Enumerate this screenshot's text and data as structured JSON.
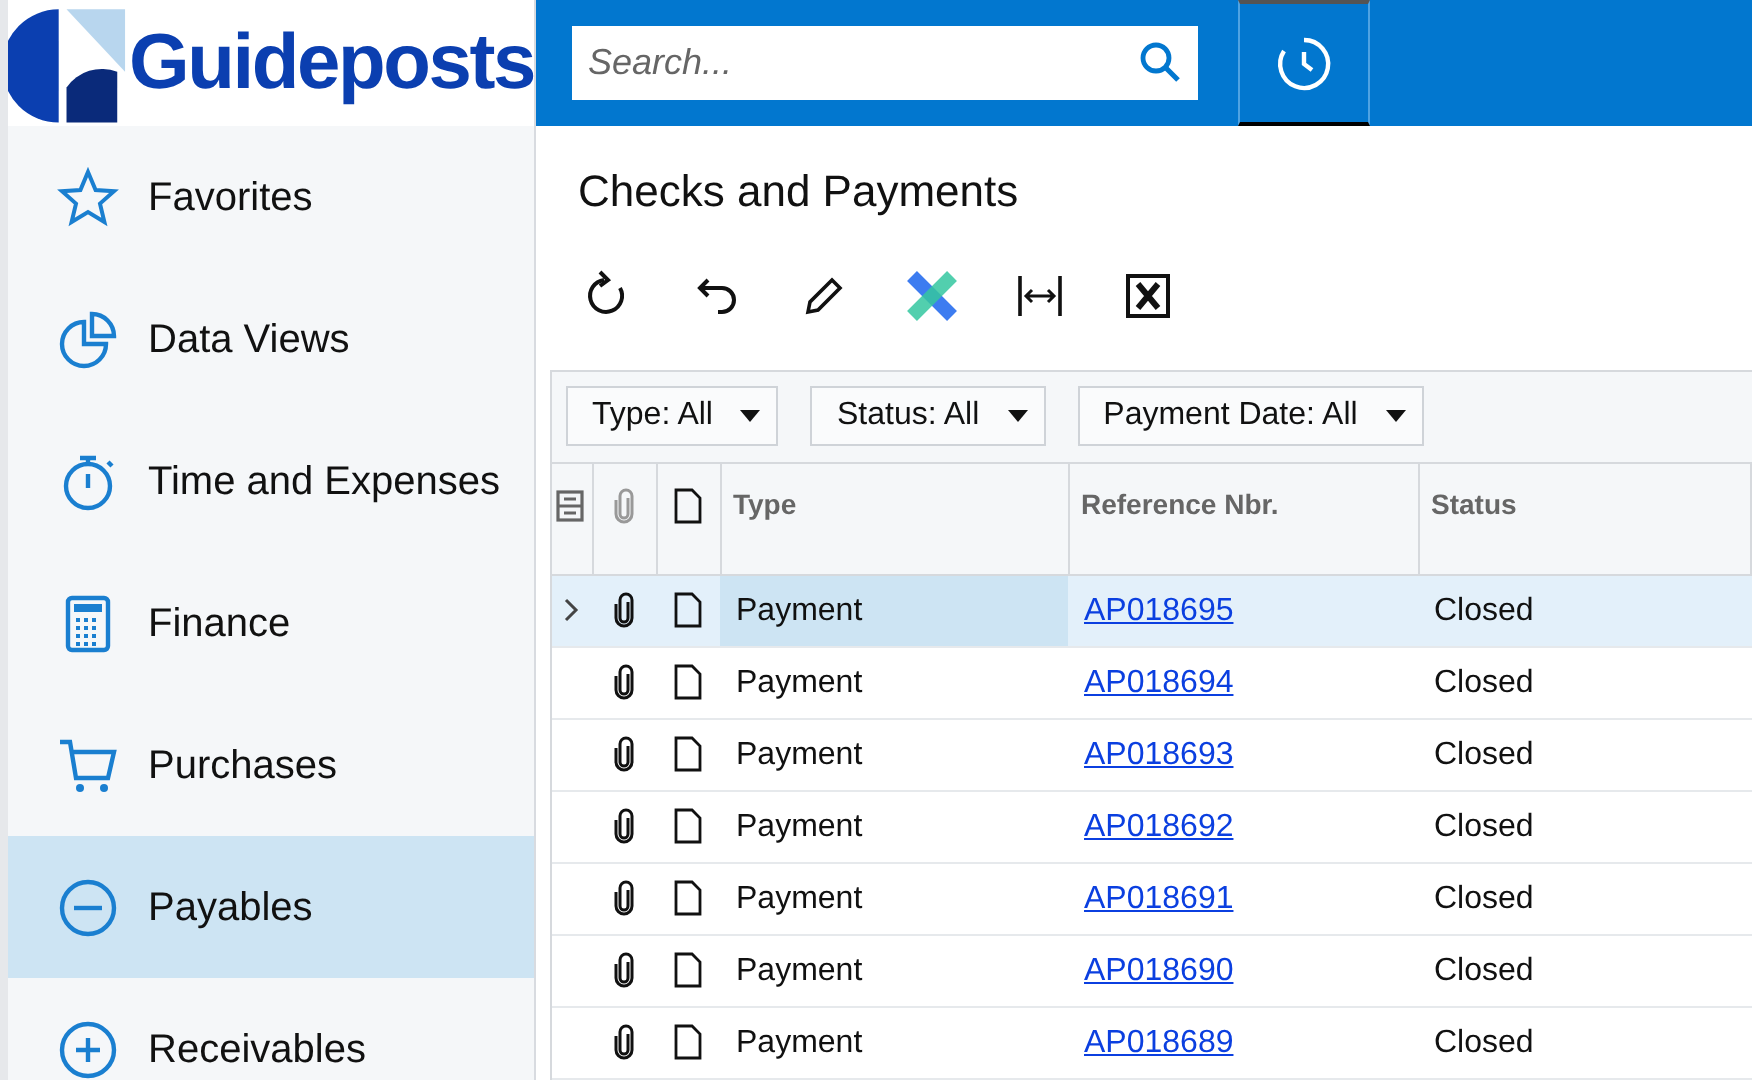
{
  "logo": {
    "text": "Guideposts"
  },
  "search": {
    "placeholder": "Search..."
  },
  "sidebar": {
    "items": [
      {
        "label": "Favorites",
        "kind": "star",
        "selected": false
      },
      {
        "label": "Data Views",
        "kind": "pie",
        "selected": false
      },
      {
        "label": "Time and Expenses",
        "kind": "timer",
        "selected": false
      },
      {
        "label": "Finance",
        "kind": "calculator",
        "selected": false
      },
      {
        "label": "Purchases",
        "kind": "cart",
        "selected": false
      },
      {
        "label": "Payables",
        "kind": "minus",
        "selected": true
      },
      {
        "label": "Receivables",
        "kind": "plus",
        "selected": false
      }
    ]
  },
  "page": {
    "title": "Checks and Payments"
  },
  "toolbar": [
    {
      "kind": "refresh"
    },
    {
      "kind": "undo"
    },
    {
      "kind": "edit"
    },
    {
      "kind": "cross"
    },
    {
      "kind": "fit"
    },
    {
      "kind": "excel"
    }
  ],
  "filters": [
    "Type: All",
    "Status: All",
    "Payment Date: All"
  ],
  "table": {
    "columns": [
      "Type",
      "Reference Nbr.",
      "Status"
    ],
    "rows": [
      {
        "type": "Payment",
        "reference": "AP018695",
        "status": "Closed",
        "selected": true
      },
      {
        "type": "Payment",
        "reference": "AP018694",
        "status": "Closed",
        "selected": false
      },
      {
        "type": "Payment",
        "reference": "AP018693",
        "status": "Closed",
        "selected": false
      },
      {
        "type": "Payment",
        "reference": "AP018692",
        "status": "Closed",
        "selected": false
      },
      {
        "type": "Payment",
        "reference": "AP018691",
        "status": "Closed",
        "selected": false
      },
      {
        "type": "Payment",
        "reference": "AP018690",
        "status": "Closed",
        "selected": false
      },
      {
        "type": "Payment",
        "reference": "AP018689",
        "status": "Closed",
        "selected": false
      }
    ]
  }
}
